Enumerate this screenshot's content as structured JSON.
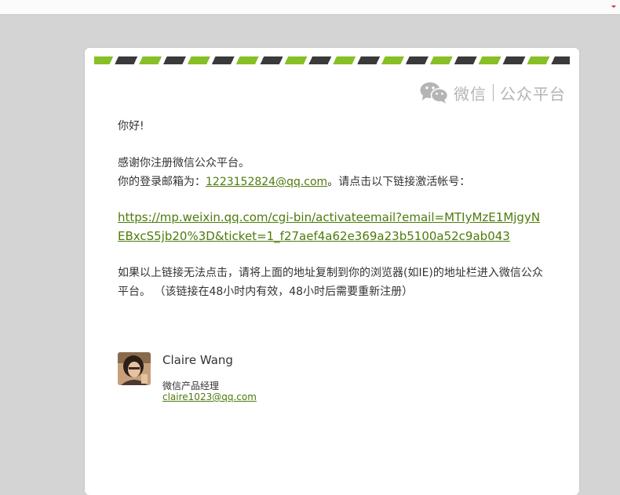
{
  "brand": {
    "name": "微信",
    "subtitle": "公众平台",
    "icon": "wechat-logo-icon",
    "color": "#b4b4b4"
  },
  "colors": {
    "background": "#d4d4d4",
    "accent_green": "#86c026",
    "stripe_dark": "#3a3a3a",
    "link": "#4e7b0b"
  },
  "email": {
    "greeting": "你好!",
    "thanks": "感谢你注册微信公众平台。",
    "login_prefix": "你的登录邮箱为：",
    "login_email": "1223152824@qq.com",
    "login_suffix": "。请点击以下链接激活帐号：",
    "activation_link": "https://mp.weixin.qq.com/cgi-bin/activateemail?email=MTIyMzE1MjgyNEBxcS5jb20%3D&ticket=1_f27aef4a62e369a23b5100a52c9ab043",
    "note": "如果以上链接无法点击，请将上面的地址复制到你的浏览器(如IE)的地址栏进入微信公众平台。 （该链接在48小时内有效，48小时后需要重新注册）"
  },
  "signature": {
    "name": "Claire Wang",
    "title": "微信产品经理",
    "email": "claire1023@qq.com"
  }
}
